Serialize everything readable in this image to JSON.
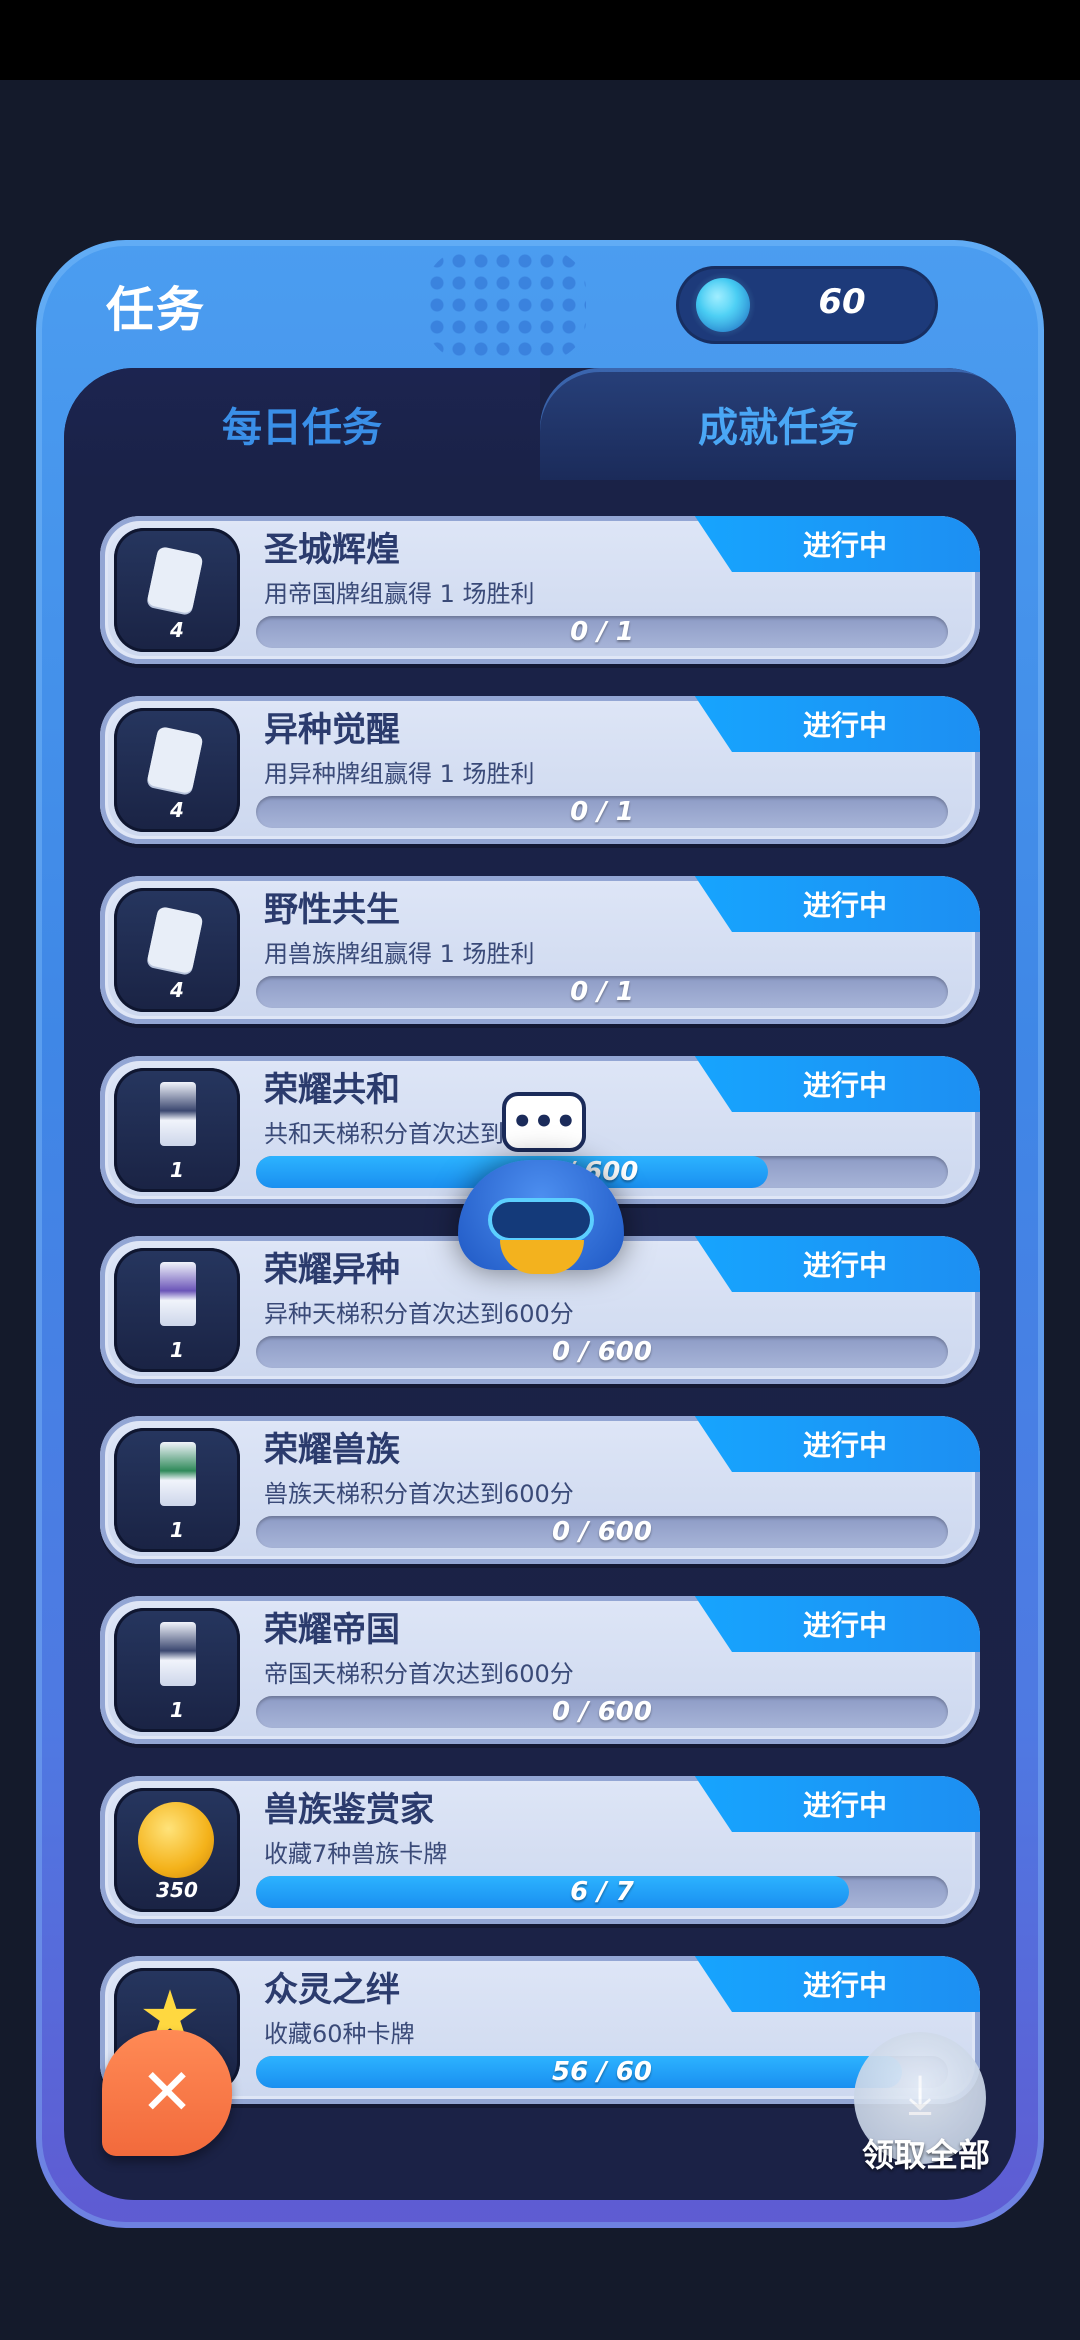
{
  "panel": {
    "title": "任务",
    "currency_value": "60",
    "currency_icon": "gem-icon"
  },
  "tabs": [
    {
      "label": "每日任务",
      "active": false
    },
    {
      "label": "成就任务",
      "active": true
    }
  ],
  "tasks": [
    {
      "title": "圣城辉煌",
      "desc": "用帝国牌组赢得 1 场胜利",
      "status": "进行中",
      "progress_text": "0 / 1",
      "progress": 0,
      "reward_count": "4",
      "reward_icon": "card-icon"
    },
    {
      "title": "异种觉醒",
      "desc": "用异种牌组赢得 1 场胜利",
      "status": "进行中",
      "progress_text": "0 / 1",
      "progress": 0,
      "reward_count": "4",
      "reward_icon": "card-icon"
    },
    {
      "title": "野性共生",
      "desc": "用兽族牌组赢得 1 场胜利",
      "status": "进行中",
      "progress_text": "0 / 1",
      "progress": 0,
      "reward_count": "4",
      "reward_icon": "card-icon"
    },
    {
      "title": "荣耀共和",
      "desc": "共和天梯积分首次达到600分",
      "status": "进行中",
      "progress_text": "/ 600",
      "progress": 0.74,
      "reward_count": "1",
      "reward_icon": "card-pack-icon"
    },
    {
      "title": "荣耀异种",
      "desc": "异种天梯积分首次达到600分",
      "status": "进行中",
      "progress_text": "0 / 600",
      "progress": 0,
      "reward_count": "1",
      "reward_icon": "card-pack-icon"
    },
    {
      "title": "荣耀兽族",
      "desc": "兽族天梯积分首次达到600分",
      "status": "进行中",
      "progress_text": "0 / 600",
      "progress": 0,
      "reward_count": "1",
      "reward_icon": "card-pack-icon"
    },
    {
      "title": "荣耀帝国",
      "desc": "帝国天梯积分首次达到600分",
      "status": "进行中",
      "progress_text": "0 / 600",
      "progress": 0,
      "reward_count": "1",
      "reward_icon": "card-pack-icon"
    },
    {
      "title": "兽族鉴赏家",
      "desc": "收藏7种兽族卡牌",
      "status": "进行中",
      "progress_text": "6 / 7",
      "progress": 0.857,
      "reward_count": "350",
      "reward_icon": "gold-coin-icon"
    },
    {
      "title": "众灵之绊",
      "desc": "收藏60种卡牌",
      "status": "进行中",
      "progress_text": "56 / 60",
      "progress": 0.933,
      "reward_count": "",
      "reward_icon": "star-icon"
    }
  ],
  "mascot": {
    "bubble": "•••"
  },
  "close_button": {
    "label": "✕"
  },
  "claim_all": {
    "label": "领取全部",
    "icon": "download-tray-icon"
  }
}
